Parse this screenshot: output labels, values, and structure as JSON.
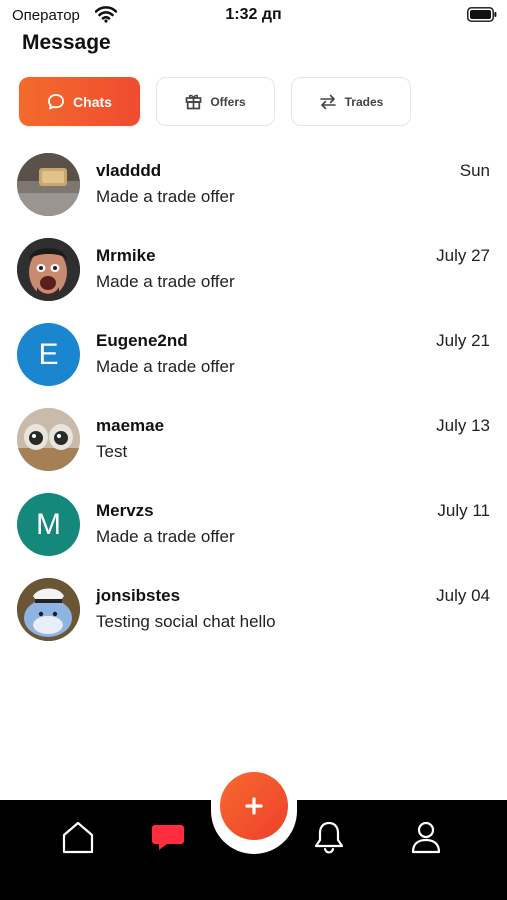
{
  "status_bar": {
    "carrier": "Оператор",
    "time": "1:32 дп"
  },
  "header": {
    "title": "Message"
  },
  "tabs": [
    {
      "label": "Chats",
      "icon": "chat-bubble-icon",
      "active": true
    },
    {
      "label": "Offers",
      "icon": "gift-icon",
      "active": false
    },
    {
      "label": "Trades",
      "icon": "swap-arrows-icon",
      "active": false
    }
  ],
  "chats": [
    {
      "name": "vladddd",
      "preview": "Made a trade offer",
      "date": "Sun",
      "avatar": "photo-avatar"
    },
    {
      "name": "Mrmike",
      "preview": "Made a trade offer",
      "date": "July 27",
      "avatar": "photo-avatar"
    },
    {
      "name": "Eugene2nd",
      "preview": "Made a trade offer",
      "date": "July 21",
      "avatar_letter": "E",
      "avatar_color": "#1a86d0"
    },
    {
      "name": "maemae",
      "preview": "Test",
      "date": "July 13",
      "avatar": "photo-avatar"
    },
    {
      "name": "Mervzs",
      "preview": "Made a trade offer",
      "date": "July 11",
      "avatar_letter": "M",
      "avatar_color": "#14887a"
    },
    {
      "name": "jonsibstes",
      "preview": "Testing social chat hello",
      "date": "July 04",
      "avatar": "photo-avatar"
    }
  ],
  "bottom_nav": {
    "items": [
      {
        "icon": "home-icon",
        "active": false
      },
      {
        "icon": "messages-icon",
        "active": true
      },
      {
        "icon": "bell-icon",
        "active": false
      },
      {
        "icon": "profile-icon",
        "active": false
      }
    ],
    "fab_icon": "plus-icon"
  },
  "colors": {
    "accent": "#f2552f",
    "nav_background": "#000000",
    "active_nav": "#ff2d3d"
  }
}
